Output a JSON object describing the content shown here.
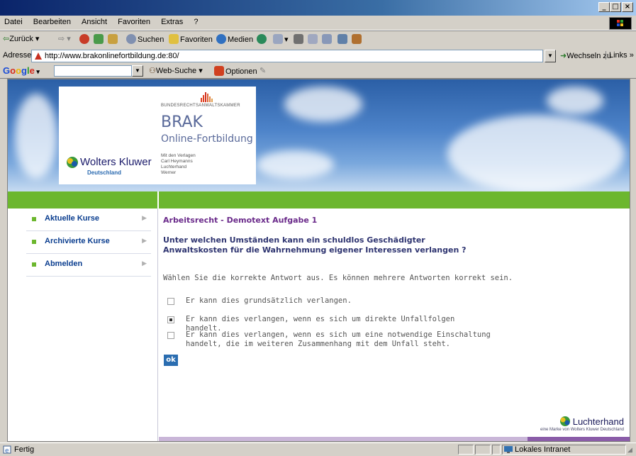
{
  "menu": [
    "Datei",
    "Bearbeiten",
    "Ansicht",
    "Favoriten",
    "Extras",
    "?"
  ],
  "toolbar": {
    "back": "Zurück",
    "search": "Suchen",
    "favorites": "Favoriten",
    "media": "Medien"
  },
  "address": {
    "label": "Adresse",
    "url": "http://www.brakonlinefortbildung.de:80/",
    "go": "Wechseln zu",
    "links": "Links »"
  },
  "google": {
    "logo_letters": [
      "G",
      "o",
      "o",
      "g",
      "l",
      "e"
    ],
    "logo_colors": [
      "#1a4cd6",
      "#d62a1a",
      "#f0b400",
      "#1a4cd6",
      "#2a9a2a",
      "#d62a1a"
    ],
    "websearch": "Web-Suche",
    "options": "Optionen"
  },
  "header": {
    "wk_name": "Wolters Kluwer",
    "wk_sub": "Deutschland",
    "brak_top": "BUNDESRECHTSANWALTSKAMMER",
    "brak_title": "BRAK",
    "brak_subtitle": "Online-Fortbildung",
    "publishers": [
      "Mit den Verlagen",
      "Carl Heymanns",
      "Luchterhand",
      "Werner"
    ]
  },
  "nav": [
    {
      "label": "Aktuelle Kurse"
    },
    {
      "label": "Archivierte Kurse"
    },
    {
      "label": "Abmelden"
    }
  ],
  "quiz": {
    "title": "Arbeitsrecht - Demotext Aufgabe 1",
    "question": "Unter welchen Umständen kann ein schuldlos Geschädigter Anwaltskosten für die Wahrnehmung eigener Interessen verlangen ?",
    "instruction": "Wählen Sie die korrekte Antwort aus. Es können mehrere Antworten korrekt sein.",
    "options": [
      {
        "text": "Er kann dies grundsätzlich verlangen.",
        "checked": false
      },
      {
        "text": "Er kann dies verlangen, wenn es sich um direkte Unfallfolgen handelt.",
        "checked": true
      },
      {
        "text": "Er kann dies verlangen, wenn es sich um eine notwendige Einschaltung handelt, die im weiteren Zusammenhang mit dem Unfall steht.",
        "checked": false
      }
    ],
    "ok": "ok"
  },
  "brand": {
    "name": "Luchterhand",
    "tagline": "eine Marke von Wolters Kluwer Deutschland"
  },
  "status": {
    "left": "Fertig",
    "zone": "Lokales Intranet"
  },
  "colors": {
    "green": "#6cb72e",
    "nav_text": "#0a3d8f",
    "title_purple": "#6a2a8a",
    "ok_blue": "#2a6db0"
  }
}
